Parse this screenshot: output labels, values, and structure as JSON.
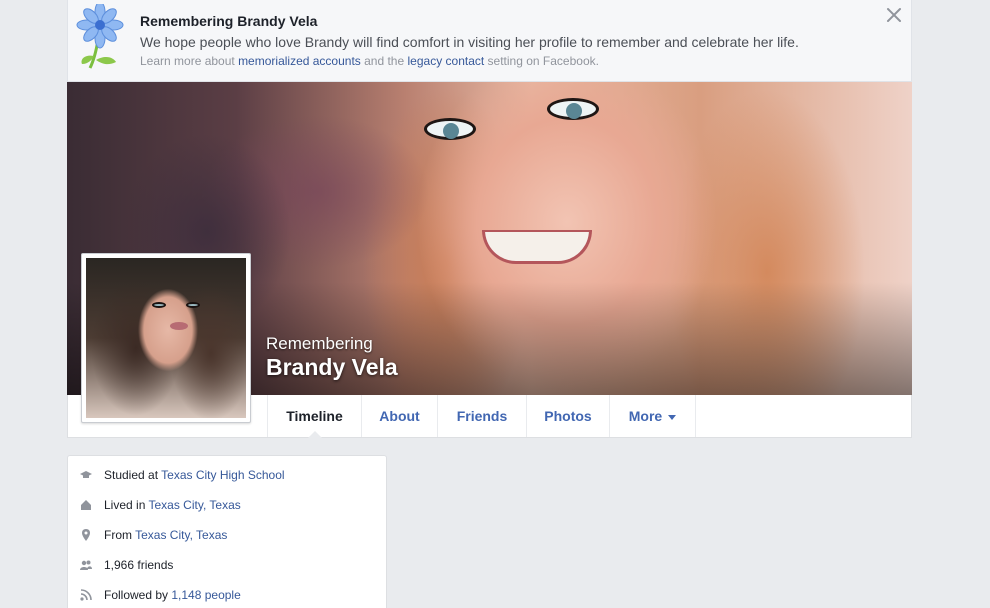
{
  "banner": {
    "title": "Remembering Brandy Vela",
    "message": "We hope people who love Brandy will find comfort in visiting her profile to remember and celebrate her life.",
    "learn_prefix": "Learn more about ",
    "learn_link1": "memorialized accounts",
    "learn_mid": " and the ",
    "learn_link2": "legacy contact",
    "learn_suffix": " setting on Facebook."
  },
  "cover": {
    "subtitle": "Remembering",
    "name": "Brandy Vela"
  },
  "nav": {
    "tabs": [
      {
        "label": "Timeline"
      },
      {
        "label": "About"
      },
      {
        "label": "Friends"
      },
      {
        "label": "Photos"
      },
      {
        "label": "More"
      }
    ]
  },
  "intro": {
    "rows": [
      {
        "icon": "graduation-cap-icon",
        "prefix": "Studied at ",
        "link": "Texas City High School"
      },
      {
        "icon": "house-icon",
        "prefix": "Lived in ",
        "link": "Texas City, Texas"
      },
      {
        "icon": "location-pin-icon",
        "prefix": "From ",
        "link": "Texas City, Texas"
      },
      {
        "icon": "friends-icon",
        "prefix": "1,966 friends",
        "link": ""
      },
      {
        "icon": "rss-icon",
        "prefix": "Followed by ",
        "link": "1,148 people"
      }
    ]
  },
  "colors": {
    "link": "#365899",
    "tab_link": "#4267b2",
    "background": "#e9ebee"
  }
}
